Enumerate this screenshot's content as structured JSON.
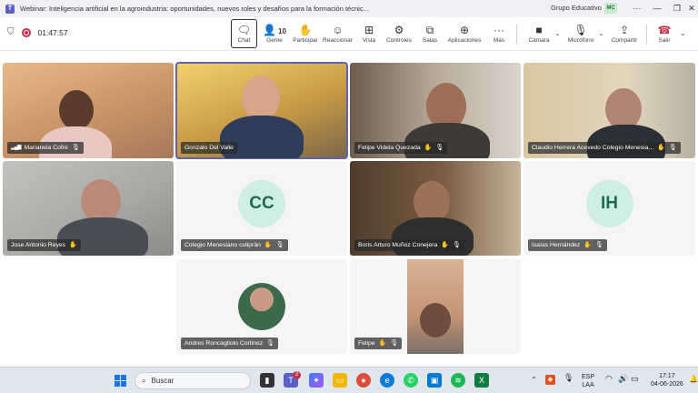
{
  "window": {
    "title": "Webinar: Inteligencia artificial en la agroindustria: oportunidades, nuevos roles y desafíos para la formación técnic...",
    "org": "Grupo Educativo",
    "org_badge": "MC"
  },
  "toolbar": {
    "timer": "01:47:57",
    "chat": "Chat",
    "people": "Gente",
    "people_count": "10",
    "raise": "Participar",
    "react": "Reaccionar",
    "view": "Vista",
    "controls": "Controles",
    "rooms": "Salas",
    "apps": "Aplicaciones",
    "more": "Más",
    "camera": "Cámara",
    "mic": "Micrófono",
    "share": "Compartir",
    "leave": "Salir"
  },
  "participants": [
    {
      "name": "Marianela Cofré"
    },
    {
      "name": "Gonzalo Del Valle"
    },
    {
      "name": "Felipe Videla Quezada"
    },
    {
      "name": "Claudio Herrera Acevedo Colegio Menesia..."
    },
    {
      "name": "Jose Antonio Reyes"
    },
    {
      "name": "Colegio Menesiano culiprán",
      "initials": "CC"
    },
    {
      "name": "Boris Arturo Muñoz Conejera"
    },
    {
      "name": "Isaías Hernández",
      "initials": "IH"
    },
    {
      "name": "Andres Roncagliolo Cortinez"
    },
    {
      "name": "Felipe"
    }
  ],
  "taskbar": {
    "search": "Buscar",
    "lang_top": "ESP",
    "lang_bottom": "LAA",
    "time": "17:17",
    "date": "04-06-2026",
    "teams_badge": "2"
  }
}
